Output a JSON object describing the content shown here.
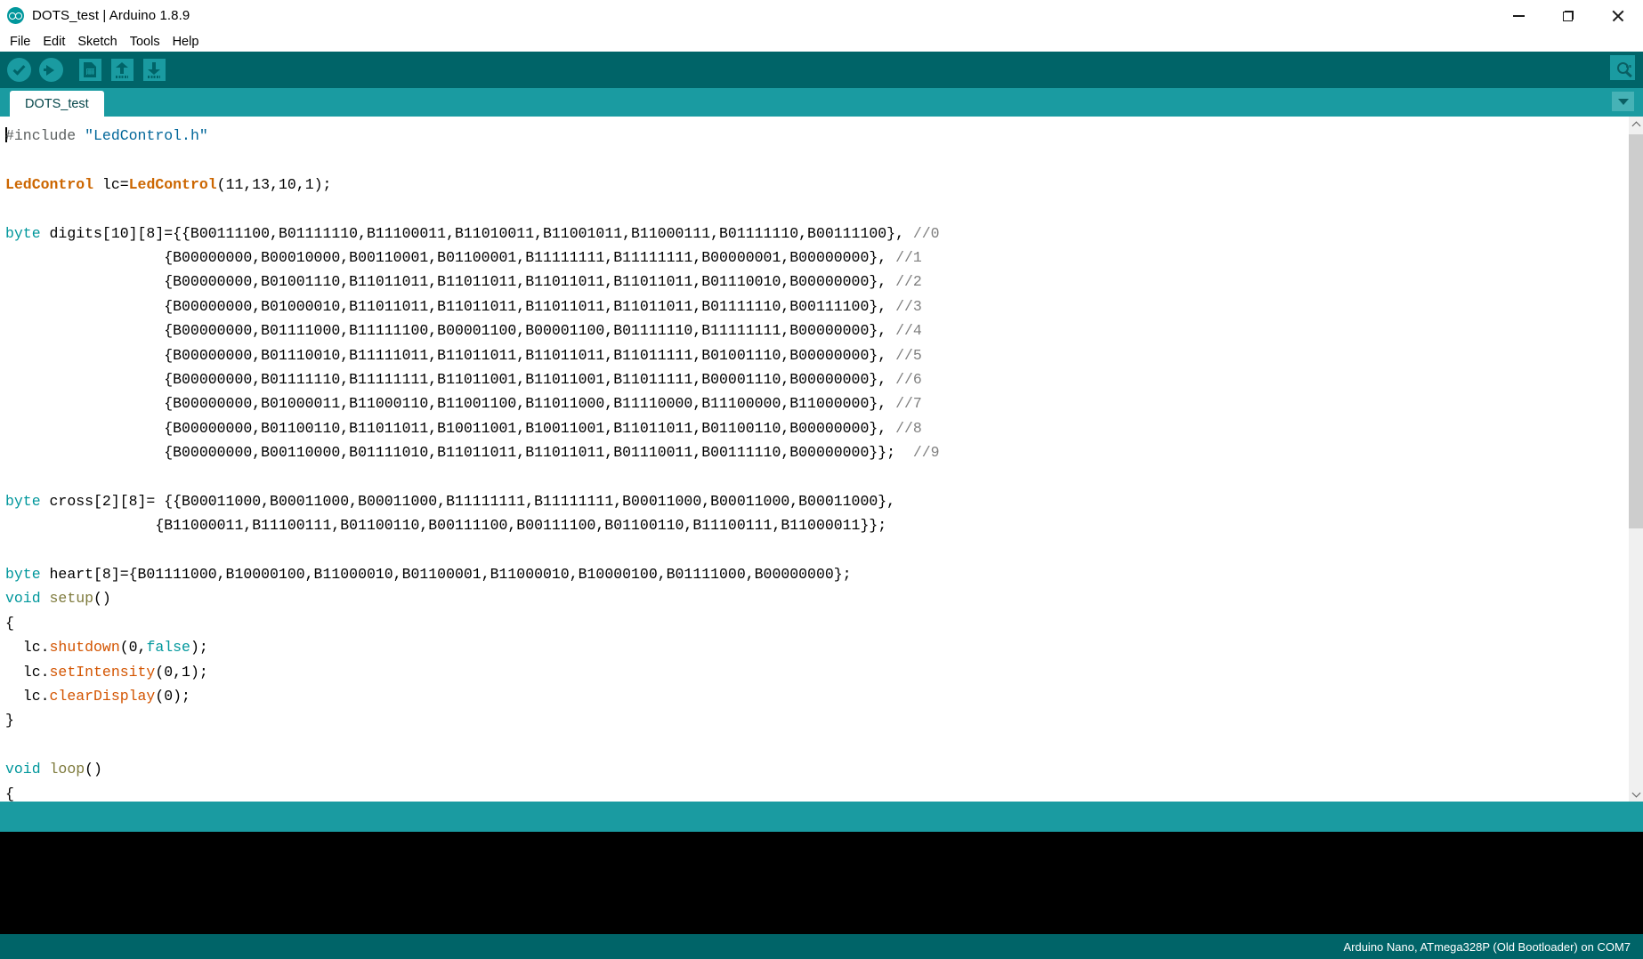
{
  "window": {
    "title": "DOTS_test | Arduino 1.8.9",
    "logo_icon": "arduino-logo-icon",
    "controls": {
      "minimize": "minimize-icon",
      "restore": "restore-icon",
      "close": "close-icon"
    }
  },
  "menubar": {
    "items": [
      {
        "label": "File"
      },
      {
        "label": "Edit"
      },
      {
        "label": "Sketch"
      },
      {
        "label": "Tools"
      },
      {
        "label": "Help"
      }
    ]
  },
  "toolbar": {
    "buttons": [
      {
        "name": "verify-button",
        "icon": "check-icon",
        "tooltip": "Verify"
      },
      {
        "name": "upload-button",
        "icon": "arrow-right-icon",
        "tooltip": "Upload"
      },
      {
        "name": "new-button",
        "icon": "new-file-icon",
        "tooltip": "New"
      },
      {
        "name": "open-button",
        "icon": "arrow-up-icon",
        "tooltip": "Open"
      },
      {
        "name": "save-button",
        "icon": "arrow-down-icon",
        "tooltip": "Save"
      }
    ],
    "serial_monitor": {
      "icon": "magnifier-icon",
      "tooltip": "Serial Monitor"
    },
    "background": "#006468",
    "accent": "#1a9ba1"
  },
  "tabs": {
    "items": [
      {
        "label": "DOTS_test",
        "active": true
      }
    ],
    "dropdown_icon": "chevron-down-icon"
  },
  "editor": {
    "lines": [
      {
        "segments": [
          {
            "t": "caret",
            "v": ""
          },
          {
            "t": "pre",
            "v": "#include"
          },
          {
            "t": "txt",
            "v": " "
          },
          {
            "t": "str",
            "v": "\"LedControl.h\""
          }
        ]
      },
      {
        "segments": []
      },
      {
        "segments": [
          {
            "t": "type",
            "v": "LedControl"
          },
          {
            "t": "txt",
            "v": " lc="
          },
          {
            "t": "type",
            "v": "LedControl"
          },
          {
            "t": "txt",
            "v": "(11,13,10,1);"
          }
        ]
      },
      {
        "segments": []
      },
      {
        "segments": [
          {
            "t": "kw",
            "v": "byte"
          },
          {
            "t": "txt",
            "v": " digits[10][8]={{B00111100,B01111110,B11100011,B11010011,B11001011,B11000111,B01111110,B00111100}, "
          },
          {
            "t": "com",
            "v": "//0"
          }
        ]
      },
      {
        "segments": [
          {
            "t": "txt",
            "v": "                  {B00000000,B00010000,B00110001,B01100001,B11111111,B11111111,B00000001,B00000000}, "
          },
          {
            "t": "com",
            "v": "//1"
          }
        ]
      },
      {
        "segments": [
          {
            "t": "txt",
            "v": "                  {B00000000,B01001110,B11011011,B11011011,B11011011,B11011011,B01110010,B00000000}, "
          },
          {
            "t": "com",
            "v": "//2"
          }
        ]
      },
      {
        "segments": [
          {
            "t": "txt",
            "v": "                  {B00000000,B01000010,B11011011,B11011011,B11011011,B11011011,B01111110,B00111100}, "
          },
          {
            "t": "com",
            "v": "//3"
          }
        ]
      },
      {
        "segments": [
          {
            "t": "txt",
            "v": "                  {B00000000,B01111000,B11111100,B00001100,B00001100,B01111110,B11111111,B00000000}, "
          },
          {
            "t": "com",
            "v": "//4"
          }
        ]
      },
      {
        "segments": [
          {
            "t": "txt",
            "v": "                  {B00000000,B01110010,B11111011,B11011011,B11011011,B11011111,B01001110,B00000000}, "
          },
          {
            "t": "com",
            "v": "//5"
          }
        ]
      },
      {
        "segments": [
          {
            "t": "txt",
            "v": "                  {B00000000,B01111110,B11111111,B11011001,B11011001,B11011111,B00001110,B00000000}, "
          },
          {
            "t": "com",
            "v": "//6"
          }
        ]
      },
      {
        "segments": [
          {
            "t": "txt",
            "v": "                  {B00000000,B01000011,B11000110,B11001100,B11011000,B11110000,B11100000,B11000000}, "
          },
          {
            "t": "com",
            "v": "//7"
          }
        ]
      },
      {
        "segments": [
          {
            "t": "txt",
            "v": "                  {B00000000,B01100110,B11011011,B10011001,B10011001,B11011011,B01100110,B00000000}, "
          },
          {
            "t": "com",
            "v": "//8"
          }
        ]
      },
      {
        "segments": [
          {
            "t": "txt",
            "v": "                  {B00000000,B00110000,B01111010,B11011011,B11011011,B01110011,B00111110,B00000000}};  "
          },
          {
            "t": "com",
            "v": "//9"
          }
        ]
      },
      {
        "segments": []
      },
      {
        "segments": [
          {
            "t": "kw",
            "v": "byte"
          },
          {
            "t": "txt",
            "v": " cross[2][8]= {{B00011000,B00011000,B00011000,B11111111,B11111111,B00011000,B00011000,B00011000},"
          }
        ]
      },
      {
        "segments": [
          {
            "t": "txt",
            "v": "                 {B11000011,B11100111,B01100110,B00111100,B00111100,B01100110,B11100111,B11000011}};"
          }
        ]
      },
      {
        "segments": []
      },
      {
        "segments": [
          {
            "t": "kw",
            "v": "byte"
          },
          {
            "t": "txt",
            "v": " heart[8]={B01111000,B10000100,B11000010,B01100001,B11000010,B10000100,B01111000,B00000000};"
          }
        ]
      },
      {
        "segments": [
          {
            "t": "kw",
            "v": "void"
          },
          {
            "t": "txt",
            "v": " "
          },
          {
            "t": "fn2",
            "v": "setup"
          },
          {
            "t": "txt",
            "v": "()"
          }
        ]
      },
      {
        "segments": [
          {
            "t": "txt",
            "v": "{"
          }
        ]
      },
      {
        "segments": [
          {
            "t": "txt",
            "v": "  lc."
          },
          {
            "t": "fn",
            "v": "shutdown"
          },
          {
            "t": "txt",
            "v": "(0,"
          },
          {
            "t": "kw",
            "v": "false"
          },
          {
            "t": "txt",
            "v": ");"
          }
        ]
      },
      {
        "segments": [
          {
            "t": "txt",
            "v": "  lc."
          },
          {
            "t": "fn",
            "v": "setIntensity"
          },
          {
            "t": "txt",
            "v": "(0,1);"
          }
        ]
      },
      {
        "segments": [
          {
            "t": "txt",
            "v": "  lc."
          },
          {
            "t": "fn",
            "v": "clearDisplay"
          },
          {
            "t": "txt",
            "v": "(0);"
          }
        ]
      },
      {
        "segments": [
          {
            "t": "txt",
            "v": "}"
          }
        ]
      },
      {
        "segments": []
      },
      {
        "segments": [
          {
            "t": "kw",
            "v": "void"
          },
          {
            "t": "txt",
            "v": " "
          },
          {
            "t": "fn2",
            "v": "loop"
          },
          {
            "t": "txt",
            "v": "()"
          }
        ]
      },
      {
        "segments": [
          {
            "t": "txt",
            "v": "{"
          }
        ]
      }
    ],
    "colors": {
      "preprocessor": "#5c6060",
      "string": "#006699",
      "type": "#cc6600",
      "keyword": "#00979c",
      "function": "#d35400",
      "function_def": "#7e7a3c",
      "comment": "#7e7e7e",
      "text": "#000000",
      "background": "#ffffff"
    },
    "scrollbar": {
      "up_icon": "chevron-up-icon",
      "down_icon": "chevron-down-icon"
    }
  },
  "console": {
    "text": "",
    "background": "#000000"
  },
  "statusbar": {
    "board_info": "Arduino Nano, ATmega328P (Old Bootloader) on COM7",
    "background": "#006468"
  }
}
